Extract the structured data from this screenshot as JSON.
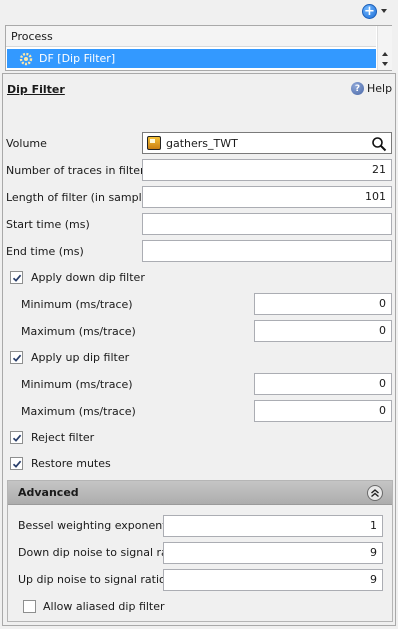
{
  "toolbar": {
    "add_icon": "add-circle-icon"
  },
  "process": {
    "header": "Process",
    "selected_row": "DF [Dip Filter]"
  },
  "panel": {
    "title": "Dip Filter",
    "help_label": "Help"
  },
  "form": {
    "volume_label": "Volume",
    "volume_value": "gathers_TWT",
    "traces_label": "Number of traces in filter",
    "traces_value": "21",
    "length_label": "Length of filter (in samples)",
    "length_value": "101",
    "start_label": "Start time (ms)",
    "start_value": "",
    "end_label": "End time (ms)",
    "end_value": "",
    "down_dip_label": "Apply down dip filter",
    "down_min_label": "Minimum (ms/trace)",
    "down_min_value": "0",
    "down_max_label": "Maximum (ms/trace)",
    "down_max_value": "0",
    "up_dip_label": "Apply up dip filter",
    "up_min_label": "Minimum (ms/trace)",
    "up_min_value": "0",
    "up_max_label": "Maximum (ms/trace)",
    "up_max_value": "0",
    "reject_label": "Reject filter",
    "restore_label": "Restore mutes"
  },
  "advanced": {
    "title": "Advanced",
    "bessel_label": "Bessel weighting exponent",
    "bessel_value": "1",
    "down_noise_label": "Down dip noise to signal ratio",
    "down_noise_value": "9",
    "up_noise_label": "Up dip noise to signal ratio",
    "up_noise_value": "9",
    "aliased_label": "Allow aliased dip filter"
  },
  "checkbox_states": {
    "apply_down_dip": true,
    "apply_up_dip": true,
    "reject_filter": true,
    "restore_mutes": true,
    "allow_aliased": false
  },
  "colors": {
    "selection": "#3399ff",
    "advanced_header": "#b8b8b8"
  }
}
